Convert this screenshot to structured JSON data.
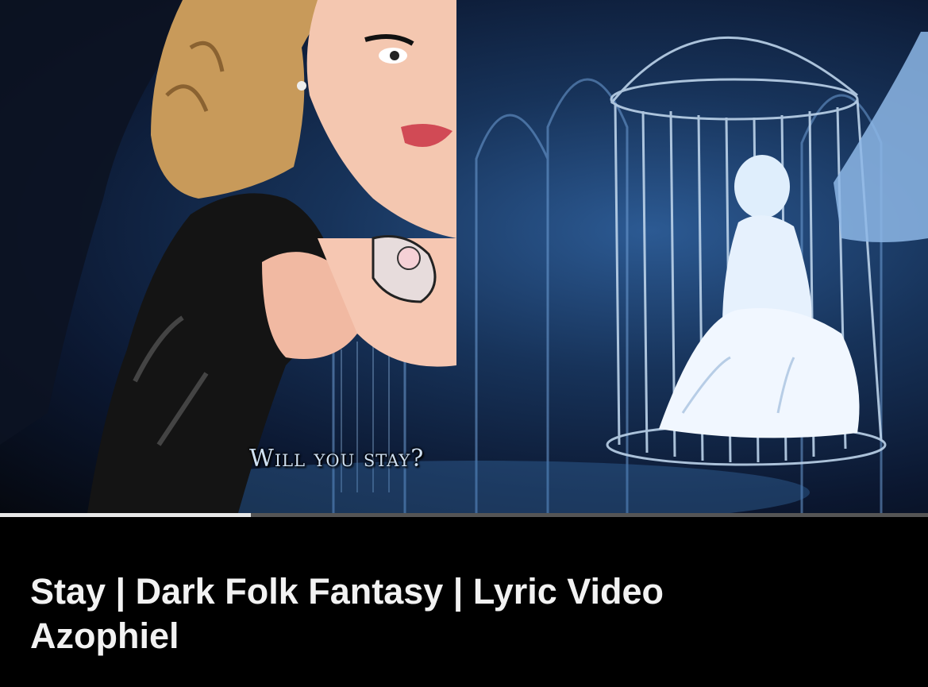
{
  "video": {
    "caption": "Will you stay?",
    "title": "Stay | Dark Folk Fantasy | Lyric Video",
    "channel": "Azophiel",
    "progress": 0.27
  }
}
